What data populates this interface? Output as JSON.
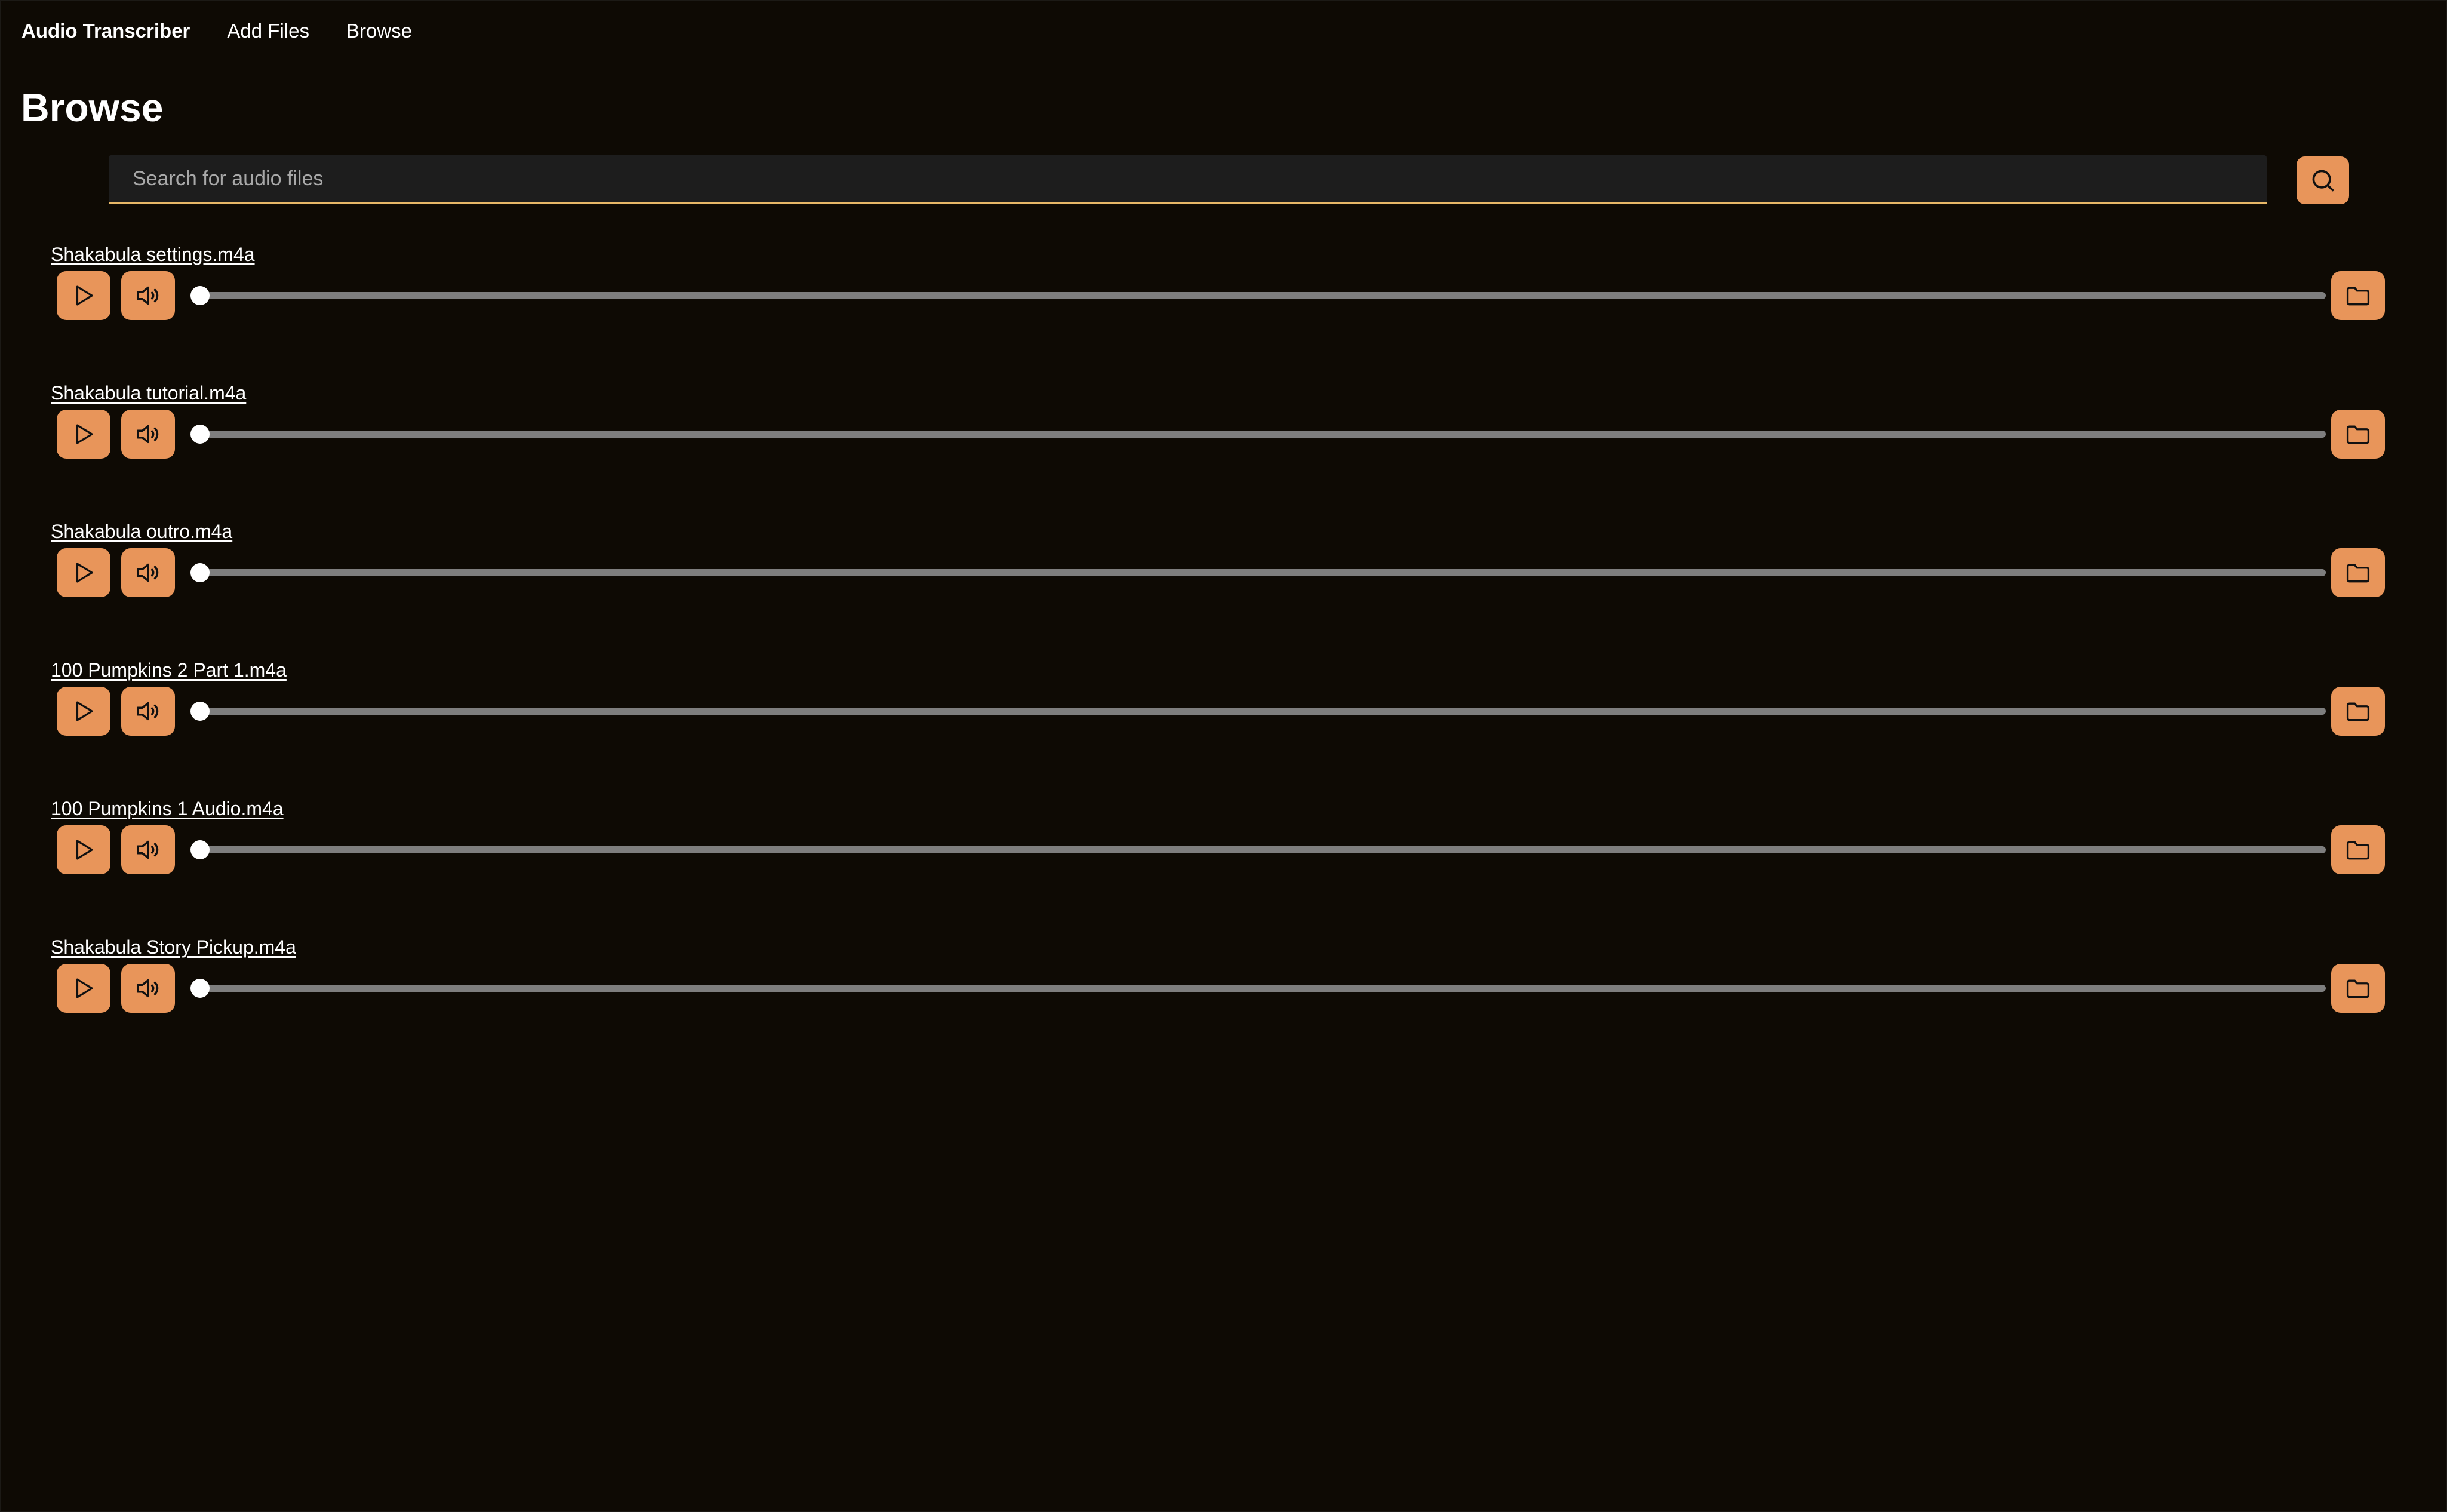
{
  "nav": {
    "brand": "Audio Transcriber",
    "add_files": "Add Files",
    "browse": "Browse"
  },
  "page": {
    "title": "Browse"
  },
  "search": {
    "placeholder": "Search for audio files",
    "value": "",
    "button_icon": "search-icon"
  },
  "colors": {
    "background": "#0e0a04",
    "accent": "#e8955a",
    "search_underline": "#e8b868",
    "track": "#7e7e7e"
  },
  "files": [
    {
      "name": "Shakabula settings.m4a",
      "progress": 0
    },
    {
      "name": "Shakabula tutorial.m4a",
      "progress": 0
    },
    {
      "name": "Shakabula outro.m4a",
      "progress": 0
    },
    {
      "name": "100 Pumpkins 2 Part 1.m4a",
      "progress": 0
    },
    {
      "name": "100 Pumpkins 1 Audio.m4a",
      "progress": 0
    },
    {
      "name": "Shakabula Story Pickup.m4a",
      "progress": 0
    }
  ],
  "item_icons": {
    "play": "play-icon",
    "volume": "volume-icon",
    "folder": "folder-icon"
  }
}
